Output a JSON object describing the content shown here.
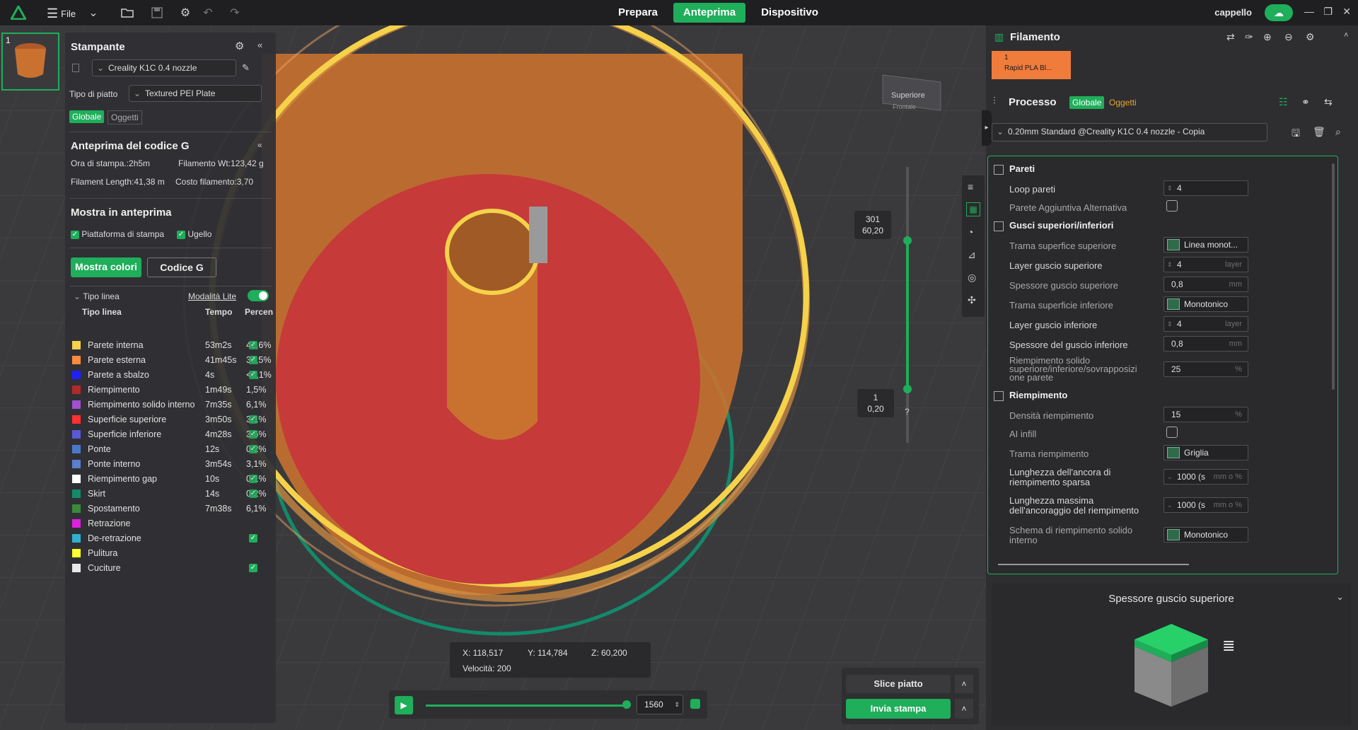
{
  "topbar": {
    "file_label": "File",
    "tabs": [
      {
        "label": "Prepara",
        "active": false
      },
      {
        "label": "Anteprima",
        "active": true
      },
      {
        "label": "Dispositivo",
        "active": false
      }
    ],
    "user": "cappello",
    "accent": "#1fae5a"
  },
  "plate": {
    "number": "1"
  },
  "printer": {
    "title": "Stampante",
    "printer_name": "Creality K1C 0.4 nozzle",
    "bed_label": "Tipo di piatto",
    "bed_value": "Textured PEI Plate",
    "scope_global": "Globale",
    "scope_objects": "Oggetti"
  },
  "gcode": {
    "title": "Anteprima del codice G",
    "print_time": "Ora di stampa.:2h5m",
    "filament_wt": "Filamento Wt:123,42 g",
    "filament_length": "Filament Length:41,38 m",
    "filament_cost": "Costo filamento:3,70",
    "show_title": "Mostra in anteprima",
    "show_bed": "Piattaforma di stampa",
    "show_nozzle": "Ugello",
    "btn_colors": "Mostra colori",
    "btn_gcode": "Codice G",
    "linetype_label": "Tipo linea",
    "lite_mode": "Modalità Lite",
    "col_type": "Tipo linea",
    "col_time": "Tempo",
    "col_pct": "Percen"
  },
  "legend": [
    {
      "name": "Parete interna",
      "time": "53m2s",
      "pct": "42,6%",
      "color": "#f5d24a",
      "check": true
    },
    {
      "name": "Parete esterna",
      "time": "41m45s",
      "pct": "33,5%",
      "color": "#ff8a3c",
      "check": true
    },
    {
      "name": "Parete a sbalzo",
      "time": "4s",
      "pct": "<0,1%",
      "color": "#2020ff",
      "check": true
    },
    {
      "name": "Riempimento",
      "time": "1m49s",
      "pct": "1,5%",
      "color": "#b02a2a",
      "check": false
    },
    {
      "name": "Riempimento solido interno",
      "time": "7m35s",
      "pct": "6,1%",
      "color": "#a050d0",
      "check": false
    },
    {
      "name": "Superficie superiore",
      "time": "3m50s",
      "pct": "3,1%",
      "color": "#ff3030",
      "check": true
    },
    {
      "name": "Superficie inferiore",
      "time": "4m28s",
      "pct": "3,6%",
      "color": "#5858d8",
      "check": true
    },
    {
      "name": "Ponte",
      "time": "12s",
      "pct": "0,2%",
      "color": "#4a78c8",
      "check": true
    },
    {
      "name": "Ponte interno",
      "time": "3m54s",
      "pct": "3,1%",
      "color": "#5a7ed0",
      "check": false
    },
    {
      "name": "Riempimento gap",
      "time": "10s",
      "pct": "0,1%",
      "color": "#ffffff",
      "check": true
    },
    {
      "name": "Skirt",
      "time": "14s",
      "pct": "0,2%",
      "color": "#138a6a",
      "check": true
    },
    {
      "name": "Spostamento",
      "time": "7m38s",
      "pct": "6,1%",
      "color": "#3a8a3a",
      "check": false
    },
    {
      "name": "Retrazione",
      "time": "",
      "pct": "",
      "color": "#e020e0",
      "check": false
    },
    {
      "name": "De-retrazione",
      "time": "",
      "pct": "",
      "color": "#30b0d0",
      "check": true
    },
    {
      "name": "Pulitura",
      "time": "",
      "pct": "",
      "color": "#ffff30",
      "check": false
    },
    {
      "name": "Cuciture",
      "time": "",
      "pct": "",
      "color": "#e8e8e8",
      "check": true
    }
  ],
  "viewport": {
    "view_top": "Superiore",
    "view_front": "Frontale",
    "layer_top_num": "301",
    "layer_top_h": "60,20",
    "layer_bot_num": "1",
    "layer_bot_h": "0,20",
    "help": "?",
    "x": "X: 118,517",
    "y": "Y: 114,784",
    "z": "Z: 60,200",
    "speed": "Velocità: 200",
    "move_count": "1560"
  },
  "slice": {
    "slice_label": "Slice piatto",
    "send_label": "Invia stampa"
  },
  "filament": {
    "title": "Filamento",
    "slot": "1",
    "name": "Rapid PLA Bl..."
  },
  "process": {
    "title": "Processo",
    "scope_global": "Globale",
    "scope_objects": "Oggetti",
    "profile": "0.20mm Standard @Creality K1C 0.4 nozzle - Copia"
  },
  "settings": {
    "sec_walls": "Pareti",
    "wall_loops_label": "Loop pareti",
    "wall_loops": "4",
    "alt_wall_label": "Parete Aggiuntiva Alternativa",
    "sec_shells": "Gusci superiori/inferiori",
    "top_pattern_label": "Trama superfice superiore",
    "top_pattern": "Linea monot...",
    "top_layers_label": "Layer guscio superiore",
    "top_layers": "4",
    "unit_layer": "layer",
    "top_thick_label": "Spessore guscio superiore",
    "top_thick": "0,8",
    "unit_mm": "mm",
    "bottom_pattern_label": "Trama superficie inferiore",
    "bottom_pattern": "Monotonico",
    "bottom_layers_label": "Layer guscio inferiore",
    "bottom_layers": "4",
    "bottom_thick_label": "Spessore del guscio inferiore",
    "bottom_thick": "0,8",
    "solid_overlap_label_1": "Riempimento solido",
    "solid_overlap_label_2": "superiore/inferiore/sovrapposizi",
    "solid_overlap_label_3": "one parete",
    "solid_overlap": "25",
    "unit_pct": "%",
    "sec_infill": "Riempimento",
    "density_label": "Densità riempimento",
    "density": "15",
    "ai_infill_label": "AI infill",
    "infill_pattern_label": "Trama riempimento",
    "infill_pattern": "Griglia",
    "anchor_label_1": "Lunghezza dell'ancora di",
    "anchor_label_2": "riempimento sparsa",
    "anchor": "1000 (s",
    "anchor_unit": "mm o %",
    "anchor_max_label_1": "Lunghezza massima",
    "anchor_max_label_2": "dell'ancoraggio del riempimento",
    "anchor_max": "1000 (s",
    "solid_pattern_label_1": "Schema di riempimento solido",
    "solid_pattern_label_2": "interno",
    "solid_pattern": "Monotonico"
  },
  "info": {
    "title": "Spessore guscio superiore"
  }
}
